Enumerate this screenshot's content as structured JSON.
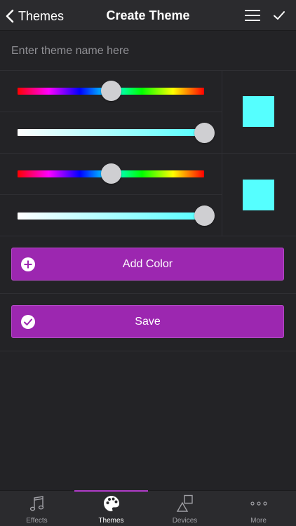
{
  "header": {
    "back_label": "Themes",
    "title": "Create Theme"
  },
  "name_field": {
    "value": "",
    "placeholder": "Enter theme name here"
  },
  "colors": [
    {
      "hue_level": 0.5,
      "saturation_level": 1.0,
      "swatch_color": "#55ffff"
    },
    {
      "hue_level": 0.5,
      "saturation_level": 1.0,
      "swatch_color": "#55ffff"
    }
  ],
  "actions": {
    "add_color_label": "Add Color",
    "save_label": "Save"
  },
  "tabs": [
    {
      "label": "Effects",
      "icon": "music-note-icon",
      "active": false
    },
    {
      "label": "Themes",
      "icon": "palette-icon",
      "active": true
    },
    {
      "label": "Devices",
      "icon": "shapes-icon",
      "active": false
    },
    {
      "label": "More",
      "icon": "more-dots-icon",
      "active": false
    }
  ],
  "theme_colors": {
    "background": "#232326",
    "bar": "#2b2b2e",
    "accent": "#9c27b0",
    "indicator": "#b03cc8"
  }
}
